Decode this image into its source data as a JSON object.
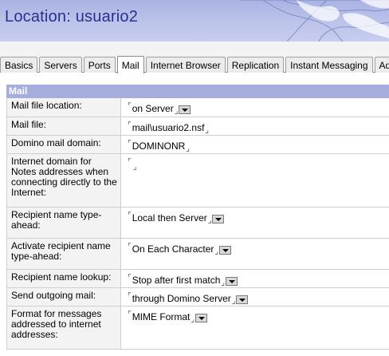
{
  "header": {
    "title": "Location: usuario2"
  },
  "tabs": [
    {
      "label": "Basics"
    },
    {
      "label": "Servers"
    },
    {
      "label": "Ports"
    },
    {
      "label": "Mail",
      "active": true
    },
    {
      "label": "Internet Browser"
    },
    {
      "label": "Replication"
    },
    {
      "label": "Instant Messaging"
    },
    {
      "label": "Ad"
    }
  ],
  "section": {
    "title": "Mail"
  },
  "fields": [
    {
      "label": "Mail file location:",
      "value": "on Server",
      "dropdown": true
    },
    {
      "label": "Mail file:",
      "value": "mail\\usuario2.nsf",
      "dropdown": false
    },
    {
      "label": "Domino mail domain:",
      "value": "DOMINONR",
      "dropdown": false
    },
    {
      "label": "Internet domain for Notes addresses when connecting directly to the Internet:",
      "value": "",
      "dropdown": false
    },
    {
      "label": "Recipient name type-ahead:",
      "value": "Local then Server",
      "dropdown": true
    },
    {
      "label": "Activate recipient name type-ahead:",
      "value": "On Each Character",
      "dropdown": true
    },
    {
      "label": "Recipient name lookup:",
      "value": "Stop after first match",
      "dropdown": true
    },
    {
      "label": "Send outgoing mail:",
      "value": "through Domino Server",
      "dropdown": true
    },
    {
      "label": "Format for messages addressed to internet addresses:",
      "value": "MIME Format",
      "dropdown": true
    }
  ],
  "icons": {
    "field_bracket": "field-bracket-icon",
    "dropdown": "dropdown-arrow-icon"
  },
  "colors": {
    "banner": "#bcc4ea",
    "title": "#2b2f8e",
    "section_header": "#a6aede"
  }
}
